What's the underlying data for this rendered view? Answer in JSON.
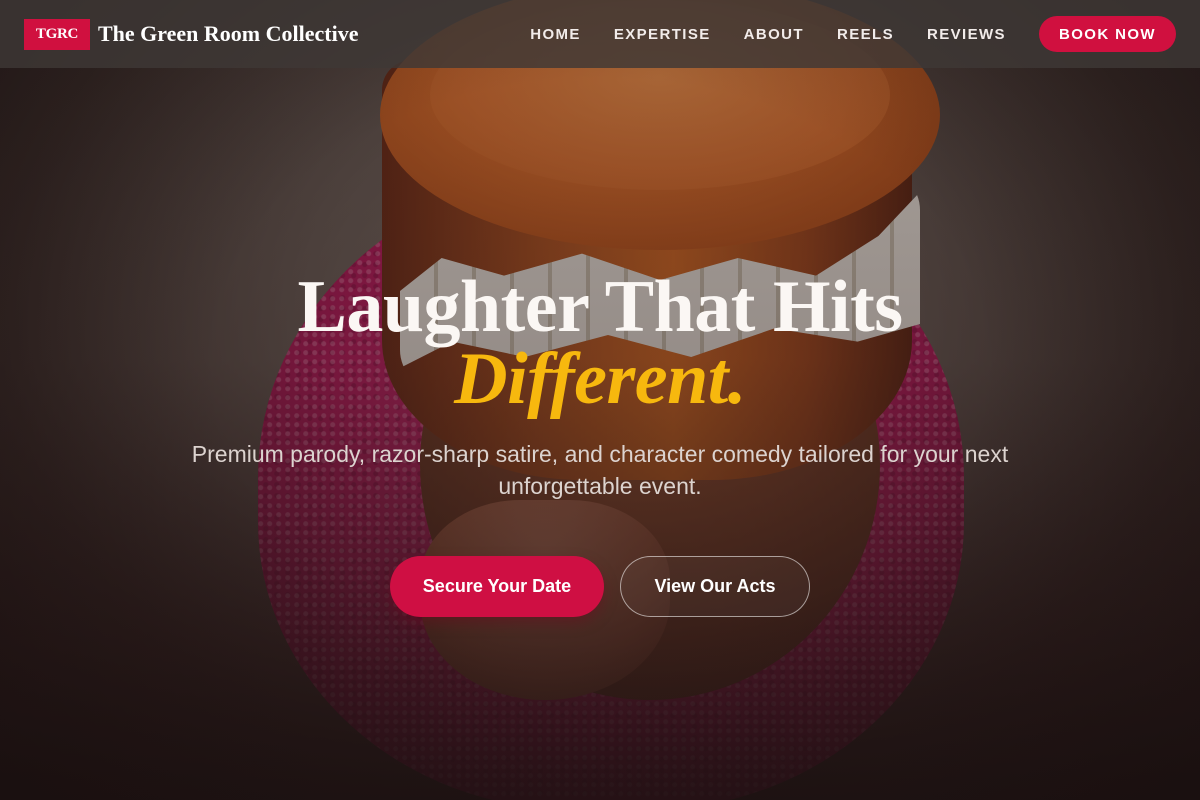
{
  "nav": {
    "brand_badge": "TGRC",
    "brand_name": "The Green Room Collective",
    "links": [
      {
        "label": "HOME"
      },
      {
        "label": "EXPERTISE"
      },
      {
        "label": "ABOUT"
      },
      {
        "label": "REELS"
      },
      {
        "label": "REVIEWS"
      }
    ],
    "cta_label": "BOOK NOW"
  },
  "hero": {
    "title_line1": "Laughter That Hits",
    "title_accent": "Different.",
    "subtitle": "Premium parody, razor-sharp satire, and character comedy tailored for your next unforgettable event.",
    "primary_button": "Secure Your Date",
    "secondary_button": "View Our Acts",
    "background_image_icon": "chattering-teeth-jar-image"
  },
  "colors": {
    "brand_accent": "#d0103f",
    "highlight": "#f7b80e",
    "nav_background": "#3e3836"
  }
}
